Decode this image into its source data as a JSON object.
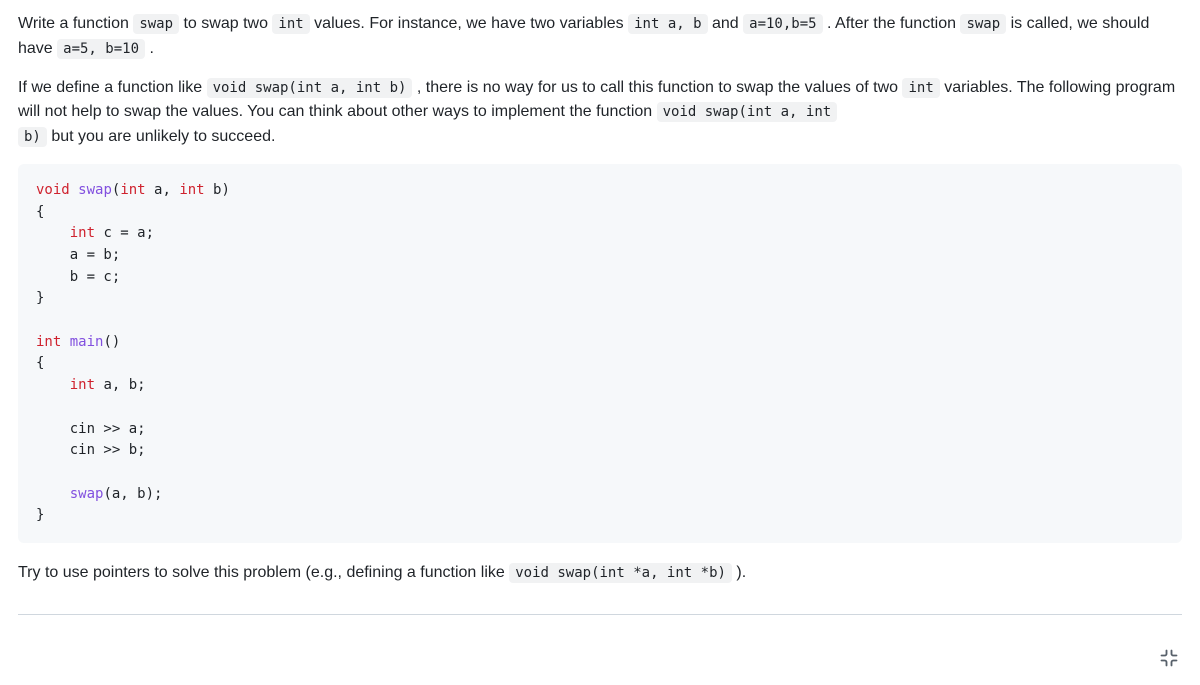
{
  "para1": {
    "s1": "Write a function ",
    "c1": "swap",
    "s2": " to swap two ",
    "c2": "int",
    "s3": " values. For instance, we have two variables ",
    "c3": "int a, b",
    "s4": " and ",
    "c4": "a=10,b=5",
    "s5": " . After the function ",
    "c5": "swap",
    "s6": " is called, we should have ",
    "c6": "a=5, b=10",
    "s7": " ."
  },
  "para2": {
    "s1": "If we define a function like ",
    "c1": "void swap(int a, int b)",
    "s2": " , there is no way for us to call this function to swap the values of two ",
    "c2": "int",
    "s3": " variables. The following program will not help to swap the values. You can think about other ways to implement the function ",
    "c3": "void swap(int a, int",
    "nl": "\n",
    "c4": "b)",
    "s4": "  but you are unlikely to succeed."
  },
  "code": {
    "l1a": "void",
    "l1b": " ",
    "l1c": "swap",
    "l1d": "(",
    "l1e": "int",
    "l1f": " a, ",
    "l1g": "int",
    "l1h": " b)",
    "l2": "{",
    "l3a": "    ",
    "l3b": "int",
    "l3c": " c = a;",
    "l4": "    a = b;",
    "l5": "    b = c;",
    "l6": "}",
    "blank1": "",
    "l7a": "int",
    "l7b": " ",
    "l7c": "main",
    "l7d": "()",
    "l8": "{",
    "l9a": "    ",
    "l9b": "int",
    "l9c": " a, b;",
    "blank2": "",
    "l10": "    cin >> a;",
    "l11": "    cin >> b;",
    "blank3": "",
    "l12a": "    ",
    "l12b": "swap",
    "l12c": "(a, b);",
    "l13": "}"
  },
  "para3": {
    "s1": "Try to use pointers to solve this problem (e.g., defining a function like ",
    "c1": "void swap(int *a, int *b)",
    "s2": " )."
  }
}
